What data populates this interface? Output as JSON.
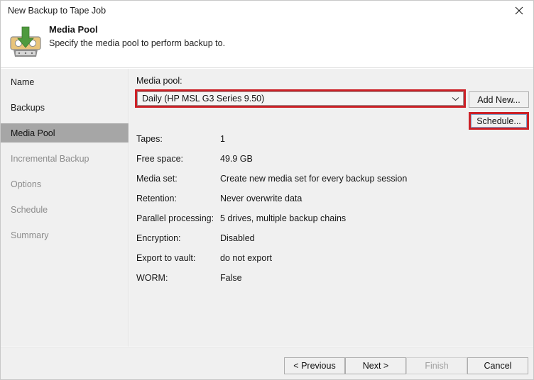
{
  "window": {
    "title": "New Backup to Tape Job",
    "close_icon": "close-icon"
  },
  "header": {
    "icon": "tape-backup-icon",
    "title": "Media Pool",
    "subtitle": "Specify the media pool to perform backup to."
  },
  "sidebar": {
    "items": [
      {
        "label": "Name",
        "state": "done"
      },
      {
        "label": "Backups",
        "state": "done"
      },
      {
        "label": "Media Pool",
        "state": "current"
      },
      {
        "label": "Incremental Backup",
        "state": "upcoming"
      },
      {
        "label": "Options",
        "state": "upcoming"
      },
      {
        "label": "Schedule",
        "state": "upcoming"
      },
      {
        "label": "Summary",
        "state": "upcoming"
      }
    ]
  },
  "main": {
    "media_pool_label": "Media pool:",
    "media_pool_value": "Daily (HP MSL G3 Series 9.50)",
    "media_pool_arrow_icon": "chevron-down-icon",
    "add_new_label": "Add New...",
    "schedule_label": "Schedule...",
    "properties": [
      {
        "key": "Tapes:",
        "value": "1"
      },
      {
        "key": "Free space:",
        "value": "49.9 GB"
      },
      {
        "key": "Media set:",
        "value": "Create new media set for every backup session"
      },
      {
        "key": "Retention:",
        "value": "Never overwrite data"
      },
      {
        "key": "Parallel processing:",
        "value": "5 drives, multiple backup chains"
      },
      {
        "key": "Encryption:",
        "value": "Disabled"
      },
      {
        "key": "Export to vault:",
        "value": "do not export"
      },
      {
        "key": "WORM:",
        "value": "False"
      }
    ]
  },
  "footer": {
    "previous_label": "< Previous",
    "next_label": "Next >",
    "finish_label": "Finish",
    "cancel_label": "Cancel"
  },
  "colors": {
    "highlight_red": "#cc2127",
    "sidebar_selected": "#a6a6a6",
    "panel_bg": "#f0f0f0",
    "icon_green": "#4e9a3e",
    "icon_tan": "#e8c47a"
  }
}
